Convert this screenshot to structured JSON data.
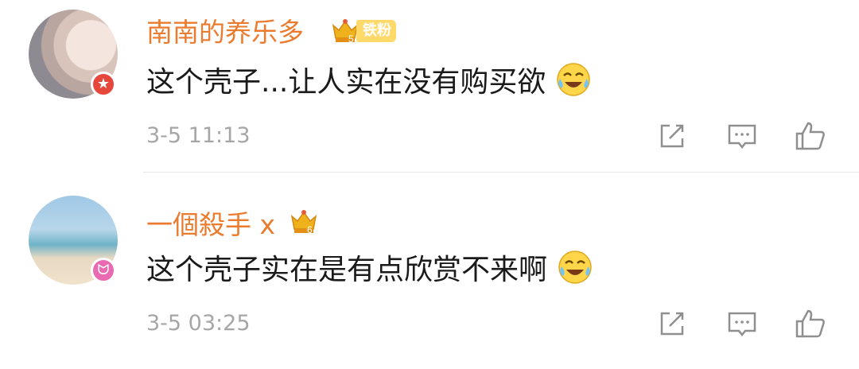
{
  "comments": [
    {
      "username": "南南的养乐多",
      "fan_level": "5",
      "fan_tag": "铁粉",
      "text": "这个壳子...让人实在没有购买欲",
      "time": "3-5 11:13",
      "badge": "★"
    },
    {
      "username": "一個殺手 x",
      "fan_level": "6",
      "text": "这个壳子实在是有点欣赏不来啊",
      "time": "3-5 03:25",
      "badge": "ᗢ"
    }
  ],
  "colors": {
    "username": "#eb7b2f",
    "text": "#1a1a1a",
    "time": "#a6a6a6",
    "icon": "#8f8f8f"
  }
}
